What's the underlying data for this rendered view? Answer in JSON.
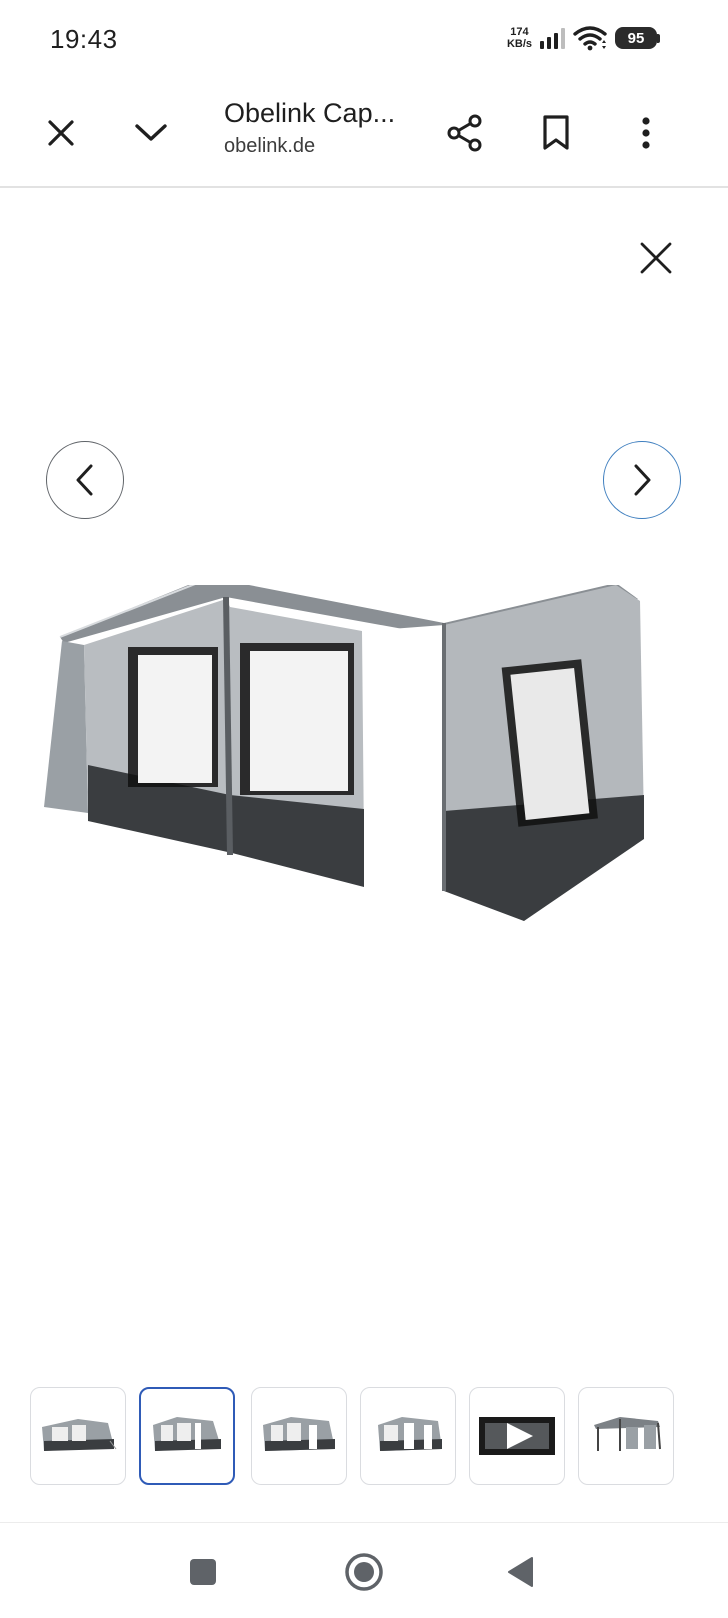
{
  "status_bar": {
    "time": "19:43",
    "net_speed_value": "174",
    "net_speed_unit": "KB/s",
    "battery": "95",
    "icons": [
      "signal-icon",
      "wifi-icon",
      "battery-icon"
    ]
  },
  "toolbar": {
    "title": "Obelink Cap...",
    "url": "obelink.de",
    "icons": [
      "close-icon",
      "chevron-down-icon",
      "share-icon",
      "bookmark-icon",
      "more-vert-icon"
    ]
  },
  "viewer": {
    "icons": [
      "close-icon",
      "chevron-left-icon",
      "chevron-right-icon"
    ],
    "image": "caravan-awning-photo",
    "thumbnails": [
      {
        "kind": "image",
        "selected": false
      },
      {
        "kind": "image",
        "selected": true
      },
      {
        "kind": "image",
        "selected": false
      },
      {
        "kind": "image",
        "selected": false
      },
      {
        "kind": "video",
        "selected": false
      },
      {
        "kind": "image",
        "selected": false
      }
    ]
  },
  "system_nav": {
    "icons": [
      "recents-square-icon",
      "home-circle-icon",
      "back-triangle-icon"
    ]
  },
  "colors": {
    "accent_selected": "#2f5bb7",
    "next_button_border": "#3f7fbf",
    "text_primary": "#1f1f1f"
  }
}
